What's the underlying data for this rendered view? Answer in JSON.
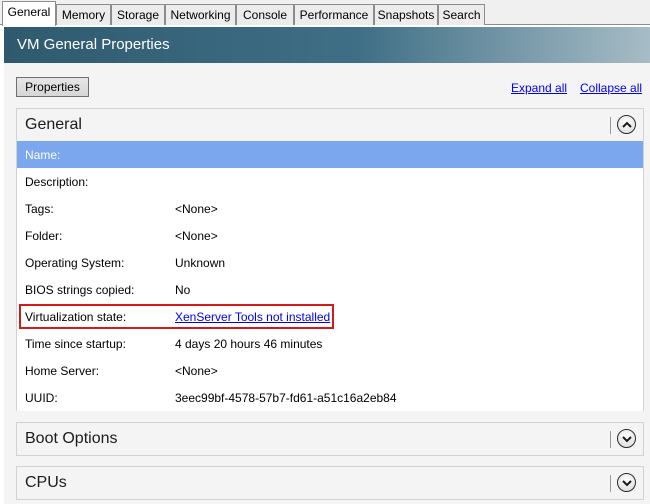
{
  "tabs": [
    {
      "label": "General",
      "active": true
    },
    {
      "label": "Memory"
    },
    {
      "label": "Storage"
    },
    {
      "label": "Networking"
    },
    {
      "label": "Console"
    },
    {
      "label": "Performance"
    },
    {
      "label": "Snapshots"
    },
    {
      "label": "Search"
    }
  ],
  "banner": {
    "title": "VM General Properties"
  },
  "toolbar": {
    "properties_label": "Properties",
    "expand_all": "Expand all",
    "collapse_all": "Collapse all"
  },
  "sections": {
    "general": {
      "title": "General",
      "expanded": true,
      "rows": [
        {
          "label": "Name:",
          "value": ""
        },
        {
          "label": "Description:",
          "value": ""
        },
        {
          "label": "Tags:",
          "value": "<None>"
        },
        {
          "label": "Folder:",
          "value": "<None>"
        },
        {
          "label": "Operating System:",
          "value": "Unknown"
        },
        {
          "label": "BIOS strings copied:",
          "value": "No"
        },
        {
          "label": "Virtualization state:",
          "value": "XenServer Tools not installed"
        },
        {
          "label": "Time since startup:",
          "value": "4 days 20 hours 46 minutes"
        },
        {
          "label": "Home Server:",
          "value": "<None>"
        },
        {
          "label": "UUID:",
          "value": "3eec99bf-4578-57b7-fd61-a51c16a2eb84"
        }
      ]
    },
    "boot": {
      "title": "Boot Options",
      "expanded": false
    },
    "cpus": {
      "title": "CPUs",
      "expanded": false
    }
  },
  "colors": {
    "banner": "#3f6f86",
    "selected_row": "#7aa7ed",
    "link": "#0000ee",
    "highlight": "#d11a1a"
  },
  "icons": {
    "collapse": "chevron-up-icon",
    "expand": "chevron-down-icon"
  }
}
